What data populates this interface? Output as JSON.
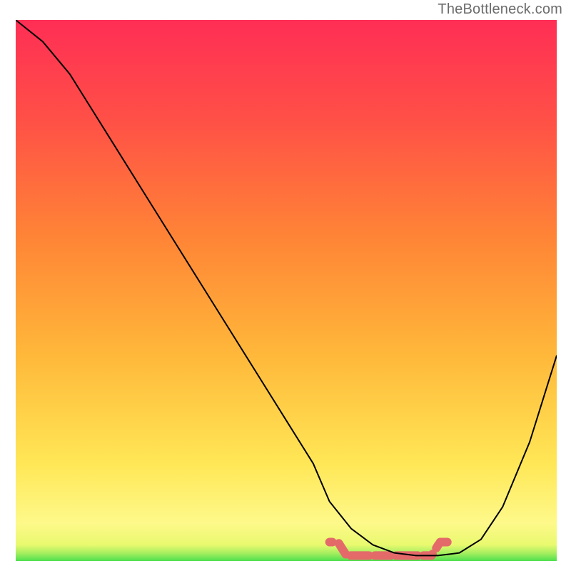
{
  "attribution": "TheBottleneck.com",
  "chart_data": {
    "type": "line",
    "title": "",
    "xlabel": "",
    "ylabel": "",
    "xlim": [
      0,
      100
    ],
    "ylim": [
      0,
      100
    ],
    "grid": false,
    "legend": false,
    "x": [
      0,
      5,
      10,
      15,
      20,
      25,
      30,
      35,
      40,
      45,
      50,
      55,
      58,
      62,
      66,
      70,
      74,
      78,
      82,
      86,
      90,
      95,
      100
    ],
    "values": [
      100,
      96,
      90,
      82,
      74,
      66,
      58,
      50,
      42,
      34,
      26,
      18,
      11,
      6,
      3,
      1.5,
      1,
      1,
      1.5,
      4,
      10,
      22,
      38
    ],
    "highlight_segment": {
      "x_start": 58,
      "x_end": 80,
      "y": 1
    },
    "gradient_stops": [
      {
        "offset": 0.0,
        "color": "#4ee04e"
      },
      {
        "offset": 0.015,
        "color": "#a8ef60"
      },
      {
        "offset": 0.03,
        "color": "#e9f96f"
      },
      {
        "offset": 0.07,
        "color": "#fef98a"
      },
      {
        "offset": 0.18,
        "color": "#ffe756"
      },
      {
        "offset": 0.38,
        "color": "#ffb83a"
      },
      {
        "offset": 0.6,
        "color": "#ff8436"
      },
      {
        "offset": 0.82,
        "color": "#ff4f47"
      },
      {
        "offset": 1.0,
        "color": "#ff2e55"
      }
    ],
    "highlight_color": "#e46a6a",
    "curve_color": "#000000",
    "curve_width": 2
  }
}
